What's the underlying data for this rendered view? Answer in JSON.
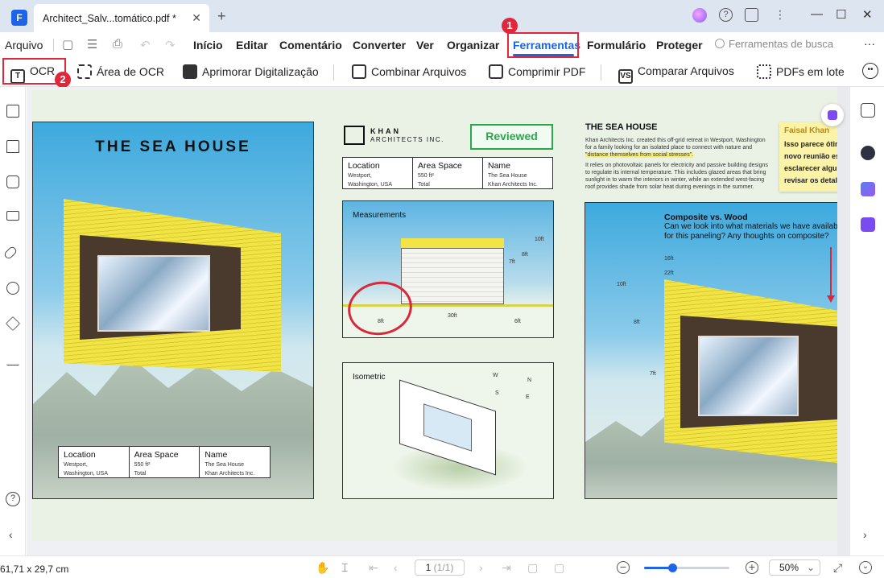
{
  "titlebar": {
    "logo": "F",
    "tab_title": "Architect_Salv...tomático.pdf *",
    "close": "✕",
    "new_tab": "+",
    "help": "?",
    "more": "⋮",
    "minimize": "—",
    "maximize": "☐",
    "close_window": "✕"
  },
  "menu": {
    "file": "Arquivo",
    "items": [
      "Início",
      "Editar",
      "Comentário",
      "Converter",
      "Ver",
      "Organizar",
      "Ferramentas",
      "Formulário",
      "Proteger"
    ],
    "search_placeholder": "Ferramentas de busca",
    "more": "···"
  },
  "tools": {
    "ocr": "OCR",
    "ocr_area": "Área de OCR",
    "enhance_scan": "Aprimorar Digitalização",
    "combine": "Combinar Arquivos",
    "compress": "Comprimir PDF",
    "compare": "Comparar Arquivos",
    "batch": "PDFs em lote"
  },
  "badges": {
    "one": "1",
    "two": "2"
  },
  "document": {
    "left_title": "THE SEA HOUSE",
    "table": {
      "location_head": "Location",
      "location_val1": "Westport,",
      "location_val2": "Washington, USA",
      "area_head": "Area Space",
      "area_val1": "550 ft²",
      "area_val2": "Total",
      "name_head": "Name",
      "name_val1": "The Sea House",
      "name_val2": "Khan Architects Inc."
    },
    "khan_name": "KHAN",
    "khan_sub": "ARCHITECTS INC.",
    "reviewed": "Reviewed",
    "measurements": "Measurements",
    "isometric": "Isometric",
    "dims": {
      "d10ft": "10ft",
      "d8ft": "8ft",
      "d7ft": "7ft",
      "d30ft": "30ft",
      "d6ft": "6ft",
      "d8ft_b": "8ft"
    },
    "compass": {
      "w": "W",
      "n": "N",
      "s": "S",
      "e": "E"
    },
    "right_title": "THE SEA HOUSE",
    "right_p1_a": "Khan Architects Inc. created this off-grid retreat in Westport, Washington",
    "right_p1_b": "for a family looking for an isolated place to connect with nature and",
    "right_p1_hl": "\"distance themselves from social stresses\".",
    "right_p2_a": "It relies on photovoltaic panels for electricity and passive building designs",
    "right_p2_b": "to regulate its internal temperature. This includes glazed areas that bring",
    "right_p2_c": "sunlight in to warm the interiors in winter, while an extended west-facing",
    "right_p2_d": "roof provides shade from solar heat during evenings in the summer.",
    "sticky_author": "Faisal Khan",
    "sticky_lines": [
      "Isso parece ótim",
      "novo reunião es",
      "esclarecer algur",
      "revisar os detalh"
    ],
    "comp_title": "Composite vs. Wood",
    "comp_line1": "Can we look into what materials we have availab",
    "comp_line2": "for this paneling? Any thoughts on composite?",
    "comp_dims": {
      "d16ft": "16ft",
      "d22ft": "22ft",
      "d10ft": "10ft",
      "d8ft": "8ft",
      "d7ft": "7ft"
    }
  },
  "status": {
    "size": "61,71 x 29,7 cm",
    "page": "1",
    "page_total": "(1/1)",
    "zoom": "50%",
    "zoom_level": 0.33,
    "zoom_minus": "−",
    "zoom_plus": "+"
  },
  "colors": {
    "accent": "#1e64e6",
    "highlight_box": "#e0283c",
    "reviewed": "#2aa84a"
  }
}
